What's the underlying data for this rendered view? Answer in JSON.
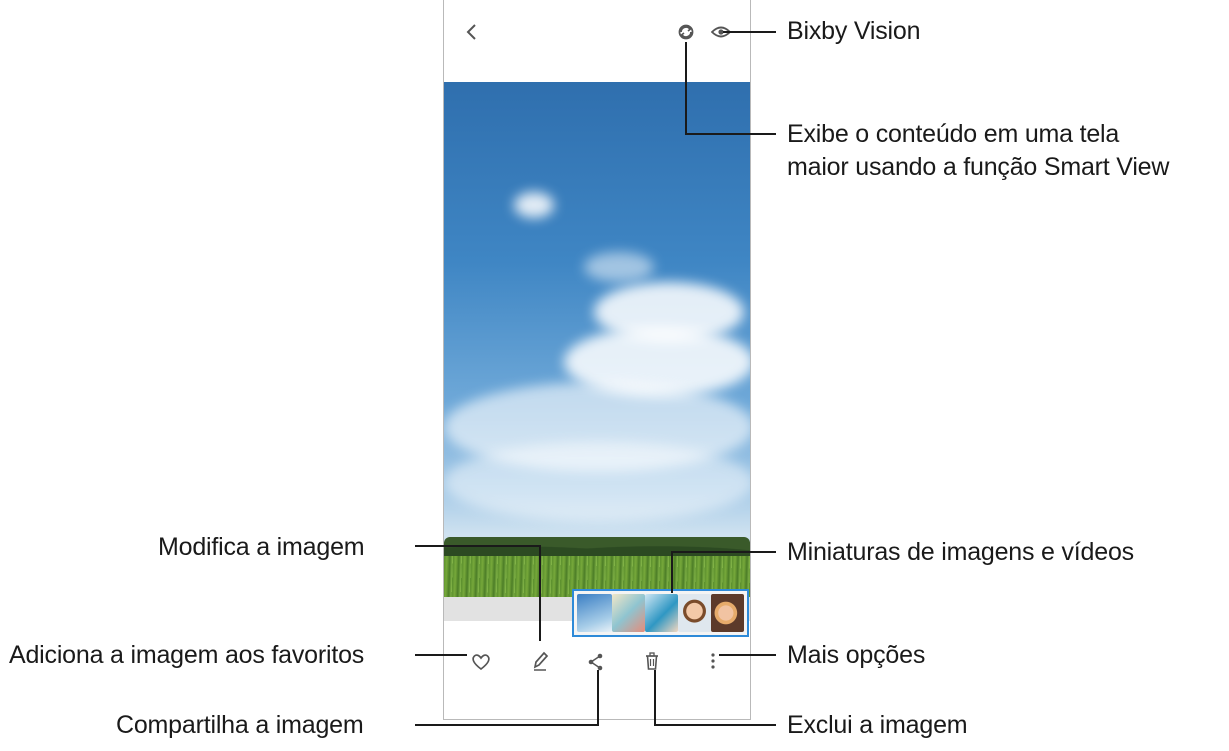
{
  "annotations": {
    "bixby_vision": "Bixby Vision",
    "smart_view_line1": "Exibe o conteúdo em uma tela",
    "smart_view_line2": "maior usando a função Smart View",
    "edit_image": "Modifica a imagem",
    "thumbnails": "Miniaturas de imagens e vídeos",
    "favorite": "Adiciona a imagem aos favoritos",
    "more_options": "Mais opções",
    "share": "Compartilha a imagem",
    "delete": "Exclui a imagem"
  },
  "icons": {
    "back": "chevron-left-icon",
    "smart_view": "smart-view-icon",
    "bixby_vision": "eye-icon",
    "favorite": "heart-icon",
    "edit": "pencil-icon",
    "share": "share-icon",
    "delete": "trash-icon",
    "more": "more-vertical-icon"
  },
  "colors": {
    "thumbnail_highlight": "#2e8ad8",
    "callout_lines": "#1a1a1a",
    "icon": "#555555"
  }
}
